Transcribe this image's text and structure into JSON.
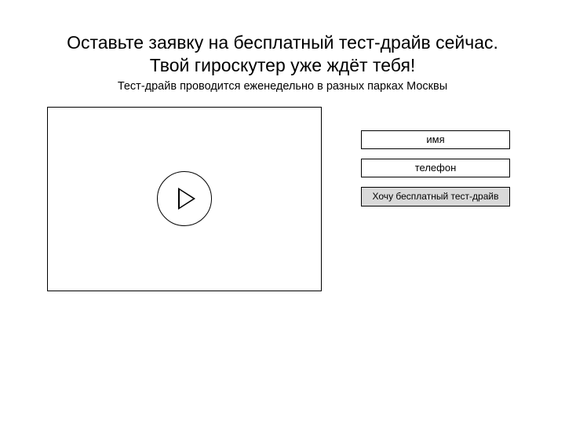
{
  "heading_line1": "Оставьте заявку на бесплатный тест-драйв сейчас.",
  "heading_line2": "Твой гироскутер уже ждёт тебя!",
  "subheading": "Тест-драйв проводится еженедельно в разных парках Москвы",
  "form": {
    "name_placeholder": "имя",
    "phone_placeholder": "телефон",
    "submit_label": "Хочу бесплатный тест-драйв"
  }
}
